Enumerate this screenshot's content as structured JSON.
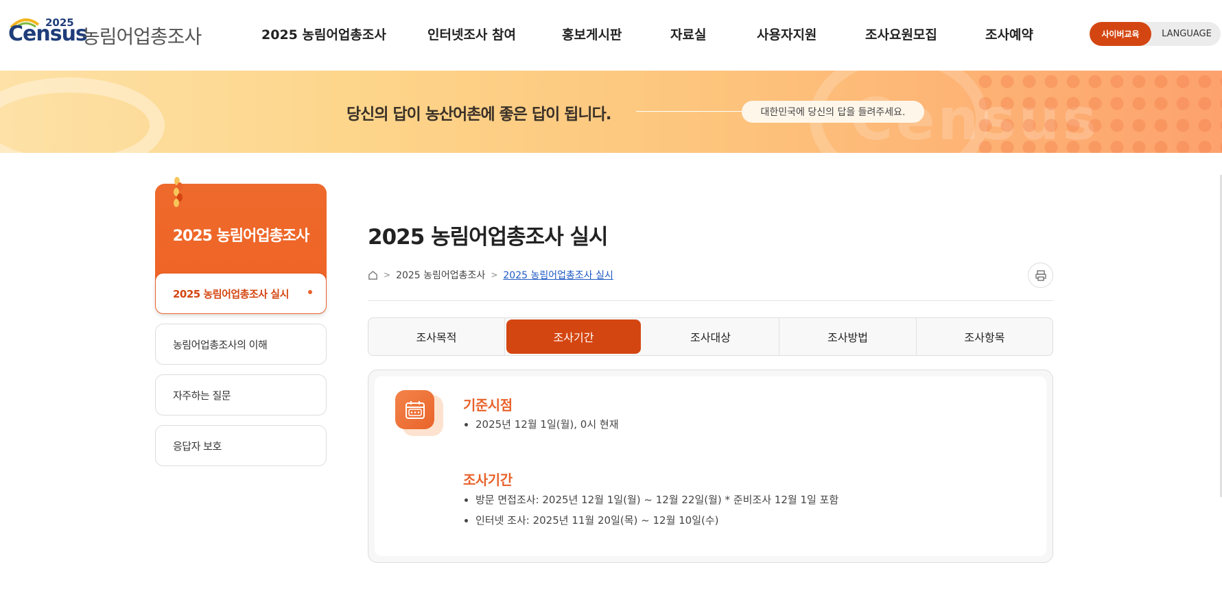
{
  "header": {
    "logo_year": "2025",
    "logo_census": "Census",
    "logo_title": "농림어업총조사",
    "nav": [
      "2025 농림어업총조사",
      "인터넷조사 참여",
      "홍보게시판",
      "자료실",
      "사용자지원",
      "조사요원모집",
      "조사예약"
    ],
    "cyber_label": "사이버교육",
    "language_label": "LANGUAGE"
  },
  "banner": {
    "title": "당신의 답이 농산어촌에 좋은 답이 됩니다.",
    "pill": "대한민국에 당신의 답을 들려주세요.",
    "deco_text": "Census"
  },
  "sidebar": {
    "title": "2025 농림어업총조사",
    "items": [
      "2025 농림어업총조사 실시",
      "농림어업총조사의 이해",
      "자주하는 질문",
      "응답자 보호"
    ],
    "active_index": 0
  },
  "content": {
    "title": "2025 농림어업총조사 실시",
    "breadcrumb": {
      "home_icon": "home-icon",
      "level1": "2025 농림어업총조사",
      "current": "2025 농림어업총조사 실시"
    },
    "tabs": [
      "조사목적",
      "조사기간",
      "조사대상",
      "조사방법",
      "조사항목"
    ],
    "active_tab": 1,
    "sections": [
      {
        "title": "기준시점",
        "items": [
          "2025년 12월 1일(월), 0시 현재"
        ]
      },
      {
        "title": "조사기간",
        "items": [
          "방문 면접조사: 2025년 12월 1일(월) ~ 12월 22일(월) * 준비조사 12월 1일 포함",
          "인터넷 조사: 2025년 11월 20일(목) ~ 12월 10일(수)"
        ]
      }
    ]
  },
  "colors": {
    "accent": "#d44611",
    "accent_light": "#e8622a",
    "brand_navy": "#1f3d7a",
    "link": "#1d59c4"
  }
}
